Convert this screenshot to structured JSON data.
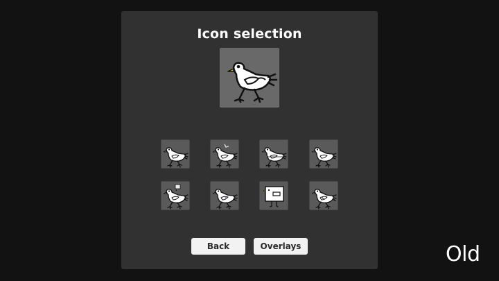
{
  "dialog": {
    "title": "Icon selection"
  },
  "preview": {
    "icon": "seagull-icon"
  },
  "icons": [
    {
      "name": "seagull-walking-icon"
    },
    {
      "name": "seagull-with-fish-icon"
    },
    {
      "name": "seagull-flat-icon"
    },
    {
      "name": "seagull-standing-icon"
    },
    {
      "name": "seagull-with-speech-icon"
    },
    {
      "name": "seagull-spotted-icon"
    },
    {
      "name": "seagull-box-icon"
    },
    {
      "name": "seagull-eye-icon"
    }
  ],
  "buttons": {
    "back_label": "Back",
    "overlays_label": "Overlays"
  },
  "watermark": {
    "text": "Old"
  },
  "colors": {
    "background": "#131213",
    "panel": "#323132",
    "preview_tile": "#6a696a",
    "icon_tile": "#5b5a5b",
    "button": "#f2f2f2",
    "beak": "#f2b600"
  }
}
